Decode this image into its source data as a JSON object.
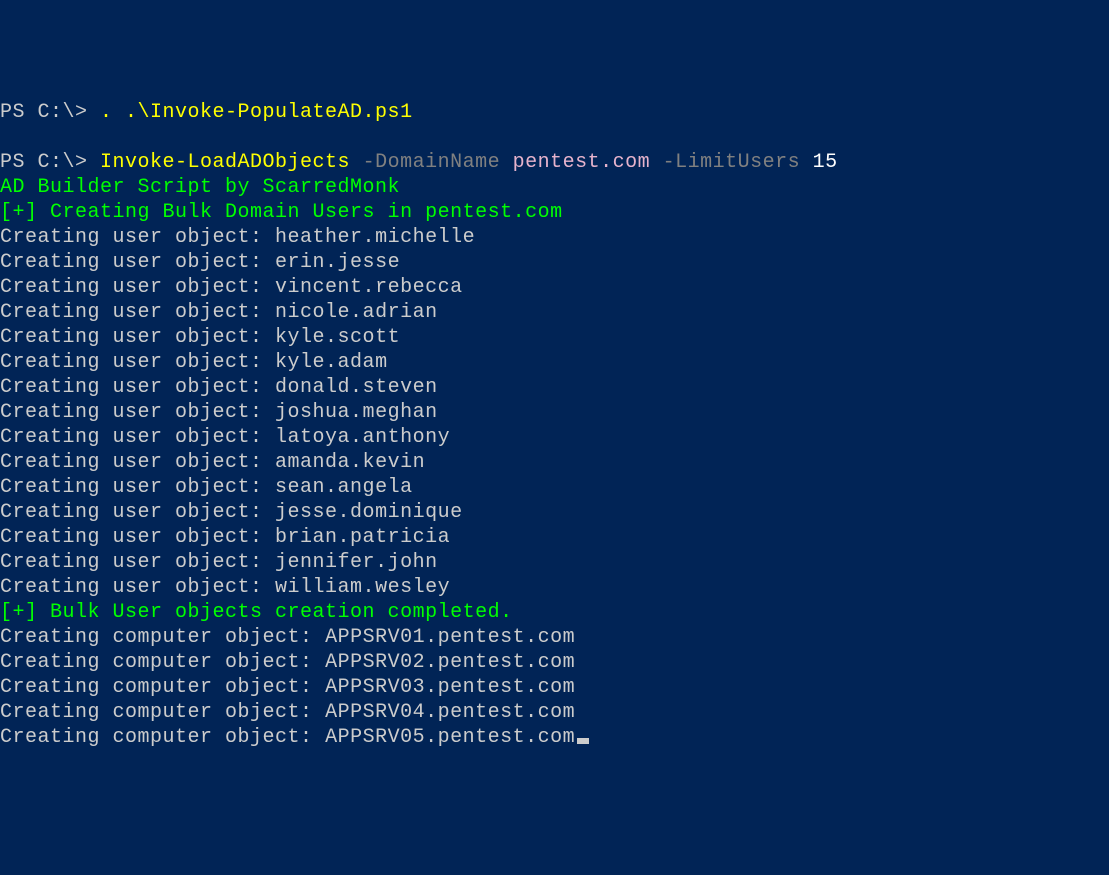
{
  "line1": {
    "prompt": "PS C:\\> ",
    "command": ". .\\Invoke-PopulateAD.ps1"
  },
  "line2": {
    "prompt": "PS C:\\> ",
    "cmdlet": "Invoke-LoadADObjects",
    "param1": " -DomainName",
    "arg1": " pentest.com",
    "param2": " -LimitUsers",
    "arg2": " 15"
  },
  "out": {
    "banner": "AD Builder Script by ScarredMonk",
    "header_users": "[+] Creating Bulk Domain Users in pentest.com",
    "users_prefix": "Creating user object: ",
    "users": [
      "heather.michelle",
      "erin.jesse",
      "vincent.rebecca",
      "nicole.adrian",
      "kyle.scott",
      "kyle.adam",
      "donald.steven",
      "joshua.meghan",
      "latoya.anthony",
      "amanda.kevin",
      "sean.angela",
      "jesse.dominique",
      "brian.patricia",
      "jennifer.john",
      "william.wesley"
    ],
    "users_done": "[+] Bulk User objects creation completed.",
    "comp_prefix": "Creating computer object: ",
    "computers": [
      "APPSRV01.pentest.com",
      "APPSRV02.pentest.com",
      "APPSRV03.pentest.com",
      "APPSRV04.pentest.com",
      "APPSRV05.pentest.com"
    ]
  }
}
